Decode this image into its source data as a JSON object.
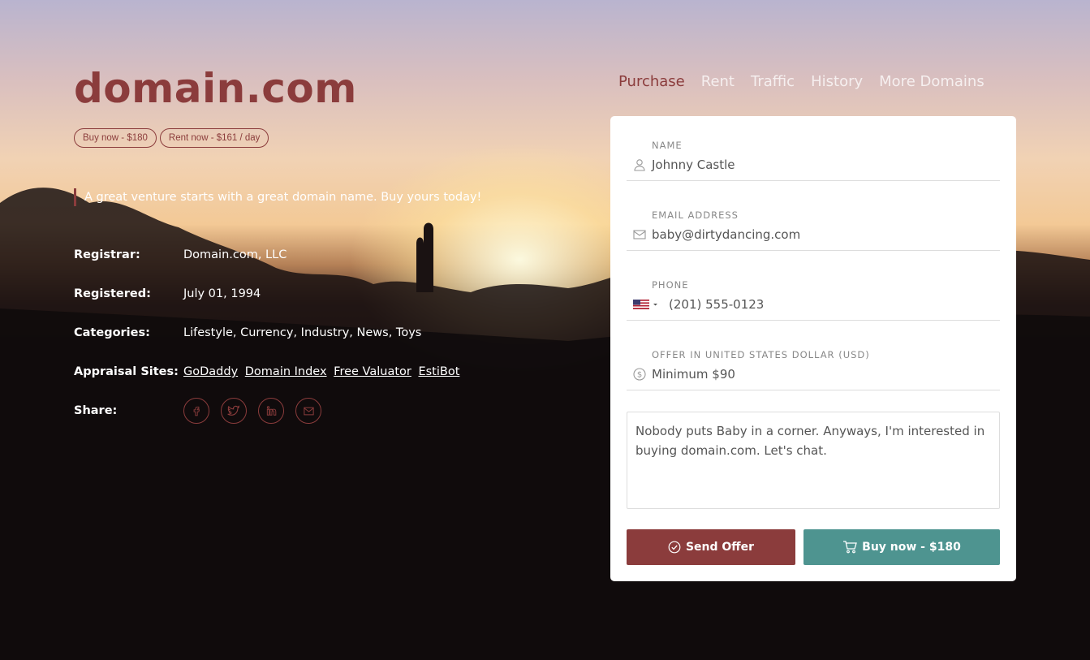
{
  "header": {
    "domain": "domain.com",
    "pills": [
      "Buy now - $180",
      "Rent now - $161 / day"
    ],
    "tagline": "A great venture starts with a great domain name. Buy yours today!"
  },
  "details": {
    "registrar_label": "Registrar:",
    "registrar_value": "Domain.com, LLC",
    "registered_label": "Registered:",
    "registered_value": "July 01, 1994",
    "categories_label": "Categories:",
    "categories_value": "Lifestyle, Currency, Industry, News, Toys",
    "appraisal_label": "Appraisal Sites:",
    "appraisal_links": [
      "GoDaddy",
      "Domain Index",
      "Free Valuator",
      "EstiBot"
    ],
    "share_label": "Share:",
    "share_icons": [
      "facebook-icon",
      "twitter-icon",
      "linkedin-icon",
      "email-icon"
    ]
  },
  "nav": {
    "items": [
      "Purchase",
      "Rent",
      "Traffic",
      "History",
      "More Domains"
    ],
    "active": "Purchase"
  },
  "form": {
    "name_label": "Name",
    "name_value": "Johnny Castle",
    "email_label": "Email Address",
    "email_value": "baby@dirtydancing.com",
    "phone_label": "Phone",
    "phone_value": "(201) 555-0123",
    "offer_label": "Offer in United States Dollar (USD)",
    "offer_placeholder": "Minimum $90",
    "message": "Nobody puts Baby in a corner. Anyways, I'm interested in buying domain.com. Let's chat.",
    "send_label": "Send Offer",
    "buy_label": "Buy now - $180"
  },
  "colors": {
    "accent": "#8b3c3c",
    "buy_button": "#4e9490"
  }
}
